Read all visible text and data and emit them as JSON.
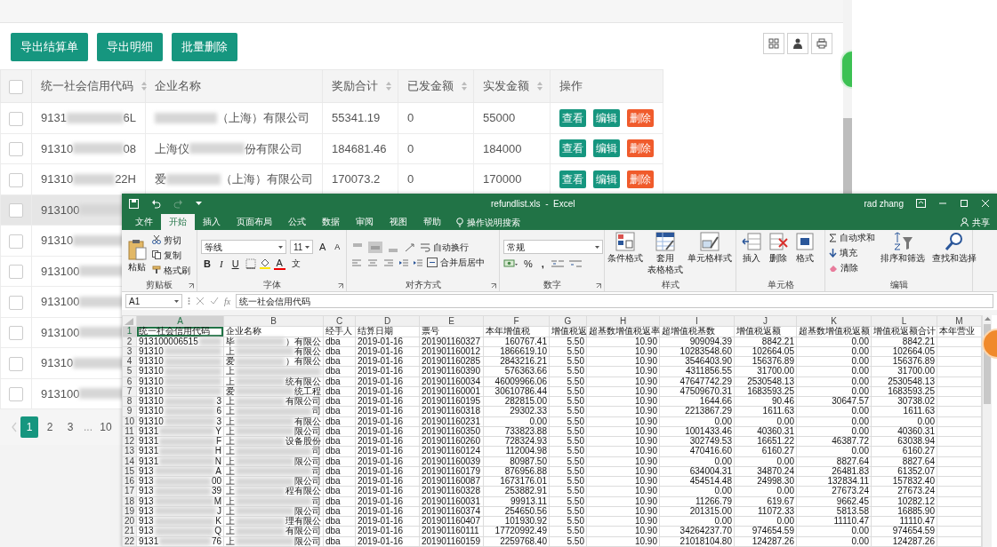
{
  "web": {
    "toolbar_buttons": [
      "导出结算单",
      "导出明细",
      "批量删除"
    ],
    "all_checked": false,
    "columns": [
      {
        "label": "统一社会信用代码",
        "sortable": true
      },
      {
        "label": "企业名称",
        "sortable": false
      },
      {
        "label": "奖励合计",
        "sortable": true
      },
      {
        "label": "已发金额",
        "sortable": true
      },
      {
        "label": "实发金额",
        "sortable": true
      },
      {
        "label": "操作",
        "sortable": false
      }
    ],
    "rows": [
      {
        "checked": false,
        "highlighted": false,
        "code": {
          "prefix": "9131",
          "suffix": "6L"
        },
        "name": {
          "suffix": "（上海）有限公司"
        },
        "total": "55341.19",
        "paid": "0",
        "actual": "55000",
        "actions": [
          {
            "label": "查看",
            "kind": "view"
          },
          {
            "label": "编辑",
            "kind": "edit"
          },
          {
            "label": "删除",
            "kind": "delete"
          }
        ]
      },
      {
        "checked": false,
        "highlighted": false,
        "code": {
          "prefix": "91310",
          "suffix": "08"
        },
        "name": {
          "prefix": "上海仪",
          "suffix": "份有限公司"
        },
        "total": "184681.46",
        "paid": "0",
        "actual": "184000",
        "actions": [
          {
            "label": "查看",
            "kind": "view"
          },
          {
            "label": "编辑",
            "kind": "edit"
          },
          {
            "label": "删除",
            "kind": "delete"
          }
        ]
      },
      {
        "checked": false,
        "highlighted": false,
        "code": {
          "prefix": "91310",
          "suffix": "22H"
        },
        "name": {
          "prefix": "爱",
          "suffix": "（上海）有限公司"
        },
        "total": "170073.2",
        "paid": "0",
        "actual": "170000",
        "actions": [
          {
            "label": "查看",
            "kind": "view"
          },
          {
            "label": "编辑",
            "kind": "edit"
          },
          {
            "label": "删除",
            "kind": "delete"
          }
        ]
      },
      {
        "checked": false,
        "highlighted": true,
        "code": {
          "prefix": "913100"
        }
      },
      {
        "checked": false,
        "highlighted": false,
        "code": {
          "prefix": "91310"
        }
      },
      {
        "checked": false,
        "highlighted": false,
        "code": {
          "prefix": "913100"
        }
      },
      {
        "checked": false,
        "highlighted": false,
        "code": {
          "prefix": "913100"
        }
      },
      {
        "checked": false,
        "highlighted": false,
        "code": {
          "prefix": "913100"
        }
      },
      {
        "checked": false,
        "highlighted": false,
        "code": {
          "prefix": "91310"
        }
      },
      {
        "checked": false,
        "highlighted": false,
        "code": {
          "prefix": "913100"
        }
      }
    ],
    "pagination": {
      "prev_disabled": true,
      "items": [
        {
          "kind": "page",
          "label": "1",
          "selected": true
        },
        {
          "kind": "page",
          "label": "2",
          "selected": false
        },
        {
          "kind": "page",
          "label": "3",
          "selected": false
        },
        {
          "kind": "gap",
          "label": "..."
        },
        {
          "kind": "page",
          "label": "10",
          "selected": false
        }
      ]
    }
  },
  "excel": {
    "title": "refundlist.xls  -  Excel",
    "user": "rad zhang",
    "redo_disabled": true,
    "tabs": [
      {
        "label": "文件",
        "selected": false
      },
      {
        "label": "开始",
        "selected": true
      },
      {
        "label": "插入",
        "selected": false
      },
      {
        "label": "页面布局",
        "selected": false
      },
      {
        "label": "公式",
        "selected": false
      },
      {
        "label": "数据",
        "selected": false
      },
      {
        "label": "审阅",
        "selected": false
      },
      {
        "label": "视图",
        "selected": false
      },
      {
        "label": "帮助",
        "selected": false
      }
    ],
    "tell_me": "操作说明搜索",
    "share": "共享",
    "ribbon": [
      {
        "kind": "clipboard",
        "title": "剪贴板",
        "paste": "粘贴",
        "cut": "剪切",
        "copy": "复制",
        "format_painter": "格式刷"
      },
      {
        "kind": "font",
        "title": "字体",
        "family": "等线",
        "size": "11",
        "grow": "A",
        "shrink": "A",
        "bold": "B",
        "italic": "I",
        "underline": "U",
        "color_letter": "A",
        "phonetic": "文"
      },
      {
        "kind": "alignment",
        "title": "对齐方式",
        "vertical": [
          {
            "selected": false
          },
          {
            "selected": true
          },
          {
            "selected": false
          }
        ],
        "wrap": "自动换行",
        "merge": "合并后居中"
      },
      {
        "kind": "number",
        "title": "数字",
        "format": "常规",
        "percent": "%",
        "comma": ","
      },
      {
        "kind": "styles",
        "title": "样式",
        "conditional": "条件格式",
        "table_lines": [
          "套用",
          "表格格式"
        ],
        "cell_styles": "单元格样式"
      },
      {
        "kind": "cells",
        "title": "单元格",
        "insert": "插入",
        "delete": "删除",
        "format": "格式"
      },
      {
        "kind": "editing",
        "title": "编辑",
        "autosum": "自动求和",
        "fill": "填充",
        "clear": "清除",
        "sort_filter": "排序和筛选",
        "find_select": "查找和选择"
      }
    ],
    "name_box": "A1",
    "fx": "fx",
    "formula": "统一社会信用代码",
    "column_letters": [
      {
        "label": "A",
        "selected": true
      },
      {
        "label": "B",
        "selected": false
      },
      {
        "label": "C",
        "selected": false
      },
      {
        "label": "D",
        "selected": false
      },
      {
        "label": "E",
        "selected": false
      },
      {
        "label": "F",
        "selected": false
      },
      {
        "label": "G",
        "selected": false
      },
      {
        "label": "H",
        "selected": false
      },
      {
        "label": "I",
        "selected": false
      },
      {
        "label": "J",
        "selected": false
      },
      {
        "label": "K",
        "selected": false
      },
      {
        "label": "L",
        "selected": false
      },
      {
        "label": "M",
        "selected": false
      }
    ],
    "header_row": {
      "number": "1",
      "selected": true,
      "cells": [
        {
          "text": "统一社会信用代码",
          "selected": true
        },
        {
          "text": "企业名称",
          "selected": false
        },
        {
          "text": "经手人",
          "selected": false
        },
        {
          "text": "结算日期",
          "selected": false
        },
        {
          "text": "票号",
          "selected": false
        },
        {
          "text": "本年增值税",
          "selected": false
        },
        {
          "text": "增值税返",
          "selected": false
        },
        {
          "text": "超基数增值税返率",
          "selected": false
        },
        {
          "text": "超增值税基数",
          "selected": false
        },
        {
          "text": "增值税返额",
          "selected": false
        },
        {
          "text": "超基数增值税返额",
          "selected": false
        },
        {
          "text": "增值税返额合计",
          "selected": false
        },
        {
          "text": "本年营业",
          "selected": false
        }
      ]
    },
    "rows": [
      {
        "number": "2",
        "a": {
          "prefix": "913100006515"
        },
        "b": {
          "prefix": "毕",
          "suffix": "）有限公"
        },
        "cells": [
          "dba",
          "2019-01-16",
          "201901160327",
          "160767.41",
          "5.50",
          "10.90",
          "909094.39",
          "8842.21",
          "0.00",
          "8842.21"
        ]
      },
      {
        "number": "3",
        "a": {
          "prefix": "91310"
        },
        "b": {
          "prefix": "上",
          "suffix": "有限公"
        },
        "cells": [
          "dba",
          "2019-01-16",
          "201901160012",
          "1866619.10",
          "5.50",
          "10.90",
          "10283548.60",
          "102664.05",
          "0.00",
          "102664.05"
        ]
      },
      {
        "number": "4",
        "a": {
          "prefix": "91310"
        },
        "b": {
          "prefix": "爱",
          "suffix": "）有限公"
        },
        "cells": [
          "dba",
          "2019-01-16",
          "201901160285",
          "2843216.21",
          "5.50",
          "10.90",
          "3546403.90",
          "156376.89",
          "0.00",
          "156376.89"
        ]
      },
      {
        "number": "5",
        "a": {
          "prefix": "91310"
        },
        "b": {
          "prefix": "上"
        },
        "cells": [
          "dba",
          "2019-01-16",
          "201901160390",
          "576363.66",
          "5.50",
          "10.90",
          "4311856.55",
          "31700.00",
          "0.00",
          "31700.00"
        ]
      },
      {
        "number": "6",
        "a": {
          "prefix": "91310"
        },
        "b": {
          "prefix": "上",
          "suffix": "统有限公"
        },
        "cells": [
          "dba",
          "2019-01-16",
          "201901160034",
          "46009966.06",
          "5.50",
          "10.90",
          "47647742.29",
          "2530548.13",
          "0.00",
          "2530548.13"
        ]
      },
      {
        "number": "7",
        "a": {
          "prefix": "91310"
        },
        "b": {
          "prefix": "爱",
          "suffix": "统工程"
        },
        "cells": [
          "dba",
          "2019-01-16",
          "201901160001",
          "30610786.44",
          "5.50",
          "10.90",
          "47509670.31",
          "1683593.25",
          "0.00",
          "1683593.25"
        ]
      },
      {
        "number": "8",
        "a": {
          "prefix": "91310",
          "suffix": "3"
        },
        "b": {
          "prefix": "上",
          "suffix": "有限公司"
        },
        "cells": [
          "dba",
          "2019-01-16",
          "201901160195",
          "282815.00",
          "5.50",
          "10.90",
          "1644.66",
          "90.46",
          "30647.57",
          "30738.02"
        ]
      },
      {
        "number": "9",
        "a": {
          "prefix": "91310",
          "suffix": "6"
        },
        "b": {
          "prefix": "上",
          "suffix": "司"
        },
        "cells": [
          "dba",
          "2019-01-16",
          "201901160318",
          "29302.33",
          "5.50",
          "10.90",
          "2213867.29",
          "1611.63",
          "0.00",
          "1611.63"
        ]
      },
      {
        "number": "10",
        "a": {
          "prefix": "91310",
          "suffix": "3"
        },
        "b": {
          "prefix": "上",
          "suffix": "有限公"
        },
        "cells": [
          "dba",
          "2019-01-16",
          "201901160231",
          "0.00",
          "5.50",
          "10.90",
          "0.00",
          "0.00",
          "0.00",
          "0.00"
        ]
      },
      {
        "number": "11",
        "a": {
          "prefix": "9131",
          "suffix": "Y"
        },
        "b": {
          "prefix": "上",
          "suffix": "限公司"
        },
        "cells": [
          "dba",
          "2019-01-16",
          "201901160350",
          "733823.88",
          "5.50",
          "10.90",
          "1001433.46",
          "40360.31",
          "0.00",
          "40360.31"
        ]
      },
      {
        "number": "12",
        "a": {
          "prefix": "9131",
          "suffix": "F"
        },
        "b": {
          "prefix": "上",
          "suffix": "设备股份"
        },
        "cells": [
          "dba",
          "2019-01-16",
          "201901160260",
          "728324.93",
          "5.50",
          "10.90",
          "302749.53",
          "16651.22",
          "46387.72",
          "63038.94"
        ]
      },
      {
        "number": "13",
        "a": {
          "prefix": "9131",
          "suffix": "H"
        },
        "b": {
          "prefix": "上",
          "suffix": "司"
        },
        "cells": [
          "dba",
          "2019-01-16",
          "201901160124",
          "112004.98",
          "5.50",
          "10.90",
          "470416.60",
          "6160.27",
          "0.00",
          "6160.27"
        ]
      },
      {
        "number": "14",
        "a": {
          "prefix": "9131",
          "suffix": "N"
        },
        "b": {
          "prefix": "上",
          "suffix": "限公司"
        },
        "cells": [
          "dba",
          "2019-01-16",
          "201901160039",
          "80987.50",
          "5.50",
          "10.90",
          "0.00",
          "0.00",
          "8827.64",
          "8827.64"
        ]
      },
      {
        "number": "15",
        "a": {
          "prefix": "913",
          "suffix": "A"
        },
        "b": {
          "prefix": "上",
          "suffix": "司"
        },
        "cells": [
          "dba",
          "2019-01-16",
          "201901160179",
          "876956.88",
          "5.50",
          "10.90",
          "634004.31",
          "34870.24",
          "26481.83",
          "61352.07"
        ]
      },
      {
        "number": "16",
        "a": {
          "prefix": "913",
          "suffix": "00"
        },
        "b": {
          "prefix": "上",
          "suffix": "限公司"
        },
        "cells": [
          "dba",
          "2019-01-16",
          "201901160087",
          "1673176.01",
          "5.50",
          "10.90",
          "454514.48",
          "24998.30",
          "132834.11",
          "157832.40"
        ]
      },
      {
        "number": "17",
        "a": {
          "prefix": "913",
          "suffix": "39"
        },
        "b": {
          "prefix": "上",
          "suffix": "程有限公"
        },
        "cells": [
          "dba",
          "2019-01-16",
          "201901160328",
          "253882.91",
          "5.50",
          "10.90",
          "0.00",
          "0.00",
          "27673.24",
          "27673.24"
        ]
      },
      {
        "number": "18",
        "a": {
          "prefix": "913",
          "suffix": "M"
        },
        "b": {
          "prefix": "上",
          "suffix": "司"
        },
        "cells": [
          "dba",
          "2019-01-16",
          "201901160031",
          "99913.11",
          "5.50",
          "10.90",
          "11266.79",
          "619.67",
          "9662.45",
          "10282.12"
        ]
      },
      {
        "number": "19",
        "a": {
          "prefix": "913",
          "suffix": "J"
        },
        "b": {
          "prefix": "上",
          "suffix": "限公司"
        },
        "cells": [
          "dba",
          "2019-01-16",
          "201901160374",
          "254650.56",
          "5.50",
          "10.90",
          "201315.00",
          "11072.33",
          "5813.58",
          "16885.90"
        ]
      },
      {
        "number": "20",
        "a": {
          "prefix": "913",
          "suffix": "K"
        },
        "b": {
          "prefix": "上",
          "suffix": "理有限公"
        },
        "cells": [
          "dba",
          "2019-01-16",
          "201901160407",
          "101930.92",
          "5.50",
          "10.90",
          "0.00",
          "0.00",
          "11110.47",
          "11110.47"
        ]
      },
      {
        "number": "21",
        "a": {
          "prefix": "913",
          "suffix": "Q"
        },
        "b": {
          "prefix": "上",
          "suffix": "有限公司"
        },
        "cells": [
          "dba",
          "2019-01-16",
          "201901160111",
          "17720992.49",
          "5.50",
          "10.90",
          "34264237.70",
          "974654.59",
          "0.00",
          "974654.59"
        ]
      },
      {
        "number": "22",
        "a": {
          "prefix": "9131",
          "suffix": "76"
        },
        "b": {
          "prefix": "上",
          "suffix": "限公司"
        },
        "cells": [
          "dba",
          "2019-01-16",
          "201901160159",
          "2259768.40",
          "5.50",
          "10.90",
          "21018104.80",
          "124287.26",
          "0.00",
          "124287.26"
        ]
      }
    ]
  }
}
